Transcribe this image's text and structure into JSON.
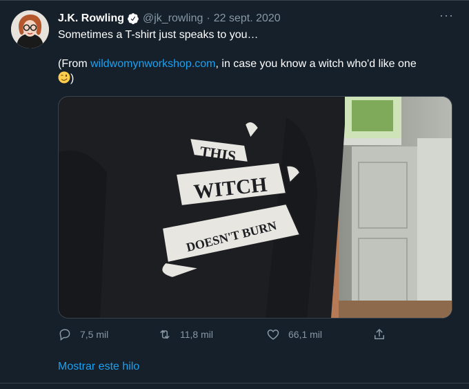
{
  "tweet": {
    "display_name": "J.K. Rowling",
    "handle": "@jk_rowling",
    "separator": "·",
    "date": "22 sept. 2020",
    "more_icon": "···",
    "text_line1": "Sometimes a T-shirt just speaks to you…",
    "text_line2_prefix": "(From ",
    "text_link": "wildwomynworkshop.com",
    "text_line2_suffix": ", in case you know a witch who'd like one",
    "text_close": ")",
    "emoji": "winking-face",
    "media": {
      "shirt_text_1": "THIS",
      "shirt_text_2": "WITCH",
      "shirt_text_3": "DOESN'T BURN"
    },
    "actions": {
      "reply_count": "7,5 mil",
      "retweet_count": "11,8 mil",
      "like_count": "66,1 mil"
    },
    "show_thread": "Mostrar este hilo"
  },
  "colors": {
    "background": "#15202b",
    "secondary_text": "#8899a6",
    "link": "#1da1f2",
    "border": "#38444d"
  }
}
